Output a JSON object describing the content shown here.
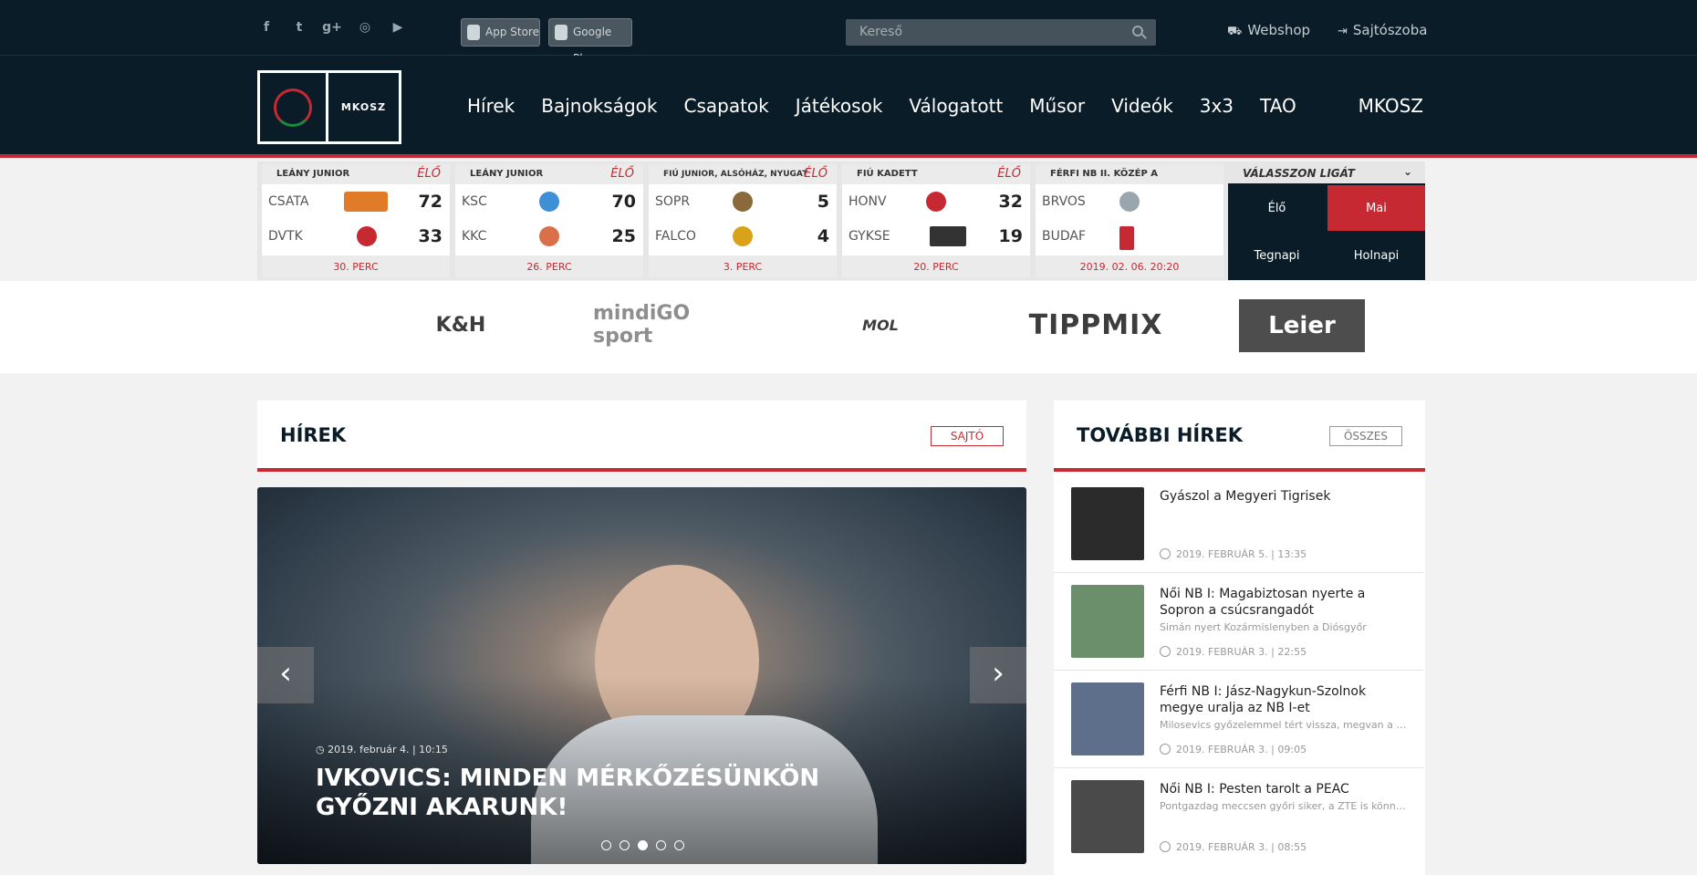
{
  "colors": {
    "navy": "#0a1c27",
    "red": "#c62931",
    "panel_bg": "#f2f2f2"
  },
  "top": {
    "social": [
      {
        "icon": "facebook-icon",
        "glyph": "f"
      },
      {
        "icon": "twitter-icon",
        "glyph": "t"
      },
      {
        "icon": "google-plus-icon",
        "glyph": "g+"
      },
      {
        "icon": "instagram-icon",
        "glyph": "◎"
      },
      {
        "icon": "youtube-icon",
        "glyph": "▶"
      }
    ],
    "appstore_label": "App Store",
    "googleplay_label": "Google Play",
    "search_placeholder": "Kereső",
    "webshop_label": "Webshop",
    "press_label": "Sajtószoba"
  },
  "nav": {
    "logo_text": "MKOSZ",
    "items": [
      "Hírek",
      "Bajnokságok",
      "Csapatok",
      "Játékosok",
      "Válogatott",
      "Műsor",
      "Videók",
      "3x3",
      "TAO"
    ],
    "right_item": "MKOSZ"
  },
  "scores": {
    "matches": [
      {
        "league": "LEÁNY JUNIOR",
        "status": "ÉLŐ",
        "home": "CSATA",
        "home_score": "72",
        "away": "DVTK",
        "away_score": "33",
        "footer": "30. PERC",
        "home_color": "#e07b2a",
        "away_color": "#c62931"
      },
      {
        "league": "LEÁNY JUNIOR",
        "status": "ÉLŐ",
        "home": "KSC",
        "home_score": "70",
        "away": "KKC",
        "away_score": "25",
        "footer": "26. PERC",
        "home_color": "#3d8fd6",
        "away_color": "#d9704a"
      },
      {
        "league": "FIÚ JUNIOR, ALSÓHÁZ, NYUGAT",
        "status": "ÉLŐ",
        "home": "SOPR",
        "home_score": "5",
        "away": "FALCO",
        "away_score": "4",
        "footer": "3. PERC",
        "home_color": "#8a6a3a",
        "away_color": "#d9a21b"
      },
      {
        "league": "FIÚ KADETT",
        "status": "ÉLŐ",
        "home": "HONV",
        "home_score": "32",
        "away": "GYKSE",
        "away_score": "19",
        "footer": "20. PERC",
        "home_color": "#c62931",
        "away_color": "#333333"
      },
      {
        "league": "FÉRFI NB II. KÖZÉP A",
        "status": "",
        "home": "BRVOS",
        "home_score": "",
        "away": "BUDAF",
        "away_score": "",
        "footer": "2019. 02. 06. 20:20",
        "home_color": "#9aa6ad",
        "away_color": "#c62931"
      }
    ],
    "league_select": "VÁLASSZON LIGÁT",
    "filters": [
      "Élő",
      "Mai",
      "Tegnapi",
      "Holnapi"
    ]
  },
  "sponsors": [
    "K&H",
    "mindiGO sport",
    "MOL",
    "TIPPMIX",
    "Leier"
  ],
  "news": {
    "title": "HÍREK",
    "press_button": "SAJTÓ",
    "slide_date": "2019. február 4. | 10:15",
    "slide_title": "IVKOVICS: MINDEN MÉRKŐZÉSÜNKÖN GYŐZNI AKARUNK!",
    "slide_index": 3,
    "slide_count": 5
  },
  "more_news": {
    "title": "TOVÁBBI HÍREK",
    "all_button": "ÖSSZES",
    "items": [
      {
        "title": "Gyászol a Megyeri Tigrisek",
        "lead": "",
        "time": "2019. FEBRUÁR 5. | 13:35",
        "thumb_color": "#2b2b2b"
      },
      {
        "title": "Női NB I: Magabiztosan nyerte a Sopron a csúcsrangadót",
        "lead": "Simán nyert Kozármislenyben a Diósgyőr",
        "time": "2019. FEBRUÁR 3. | 22:55",
        "thumb_color": "#6a8f6a"
      },
      {
        "title": "Férfi NB I: Jász-Nagykun-Szolnok megye uralja az NB I-et",
        "lead": "Milosevics győzelemmel tért vissza, megvan a hete...",
        "time": "2019. FEBRUÁR 3. | 09:05",
        "thumb_color": "#5d6f8a"
      },
      {
        "title": "Női NB I: Pesten tarolt a PEAC",
        "lead": "Pontgazdag meccsen győri siker, a ZTE is könnyedé...",
        "time": "2019. FEBRUÁR 3. | 08:55",
        "thumb_color": "#4a4a4a"
      }
    ]
  }
}
